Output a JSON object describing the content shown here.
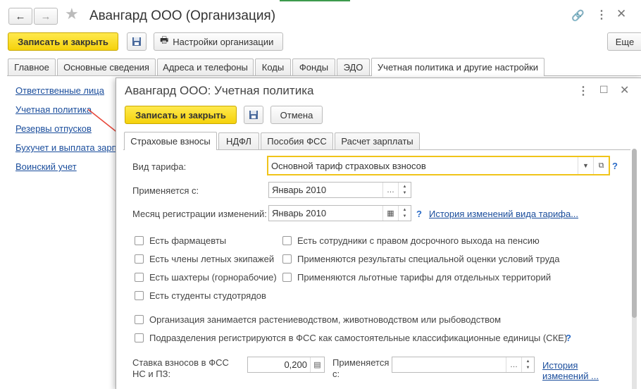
{
  "window": {
    "title": "Авангард ООО (Организация)",
    "save_close": "Записать и закрыть",
    "settings_btn": "Настройки организации",
    "more": "Еще",
    "tabs": [
      {
        "label": "Главное"
      },
      {
        "label": "Основные сведения"
      },
      {
        "label": "Адреса и телефоны"
      },
      {
        "label": "Коды"
      },
      {
        "label": "Фонды"
      },
      {
        "label": "ЭДО"
      },
      {
        "label": "Учетная политика и другие настройки"
      }
    ]
  },
  "left_links": [
    {
      "label": "Ответственные лица"
    },
    {
      "label": "Учетная политика"
    },
    {
      "label": "Резервы отпусков"
    },
    {
      "label": "Бухучет и выплата зарплаты"
    },
    {
      "label": "Воинский учет"
    }
  ],
  "dialog": {
    "title": "Авангард ООО: Учетная политика",
    "save_close": "Записать и закрыть",
    "cancel": "Отмена",
    "tabs": [
      {
        "label": "Страховые взносы"
      },
      {
        "label": "НДФЛ"
      },
      {
        "label": "Пособия ФСС"
      },
      {
        "label": "Расчет зарплаты"
      }
    ],
    "tariff_label": "Вид тарифа:",
    "tariff_value": "Основной тариф страховых взносов",
    "applies_label": "Применяется с:",
    "applies_value": "Январь 2010",
    "reg_month_label": "Месяц регистрации изменений:",
    "reg_month_value": "Январь 2010",
    "history_link": "История изменений вида тарифа...",
    "help_q": "?",
    "checks_left": [
      {
        "label": "Есть фармацевты"
      },
      {
        "label": "Есть члены летных экипажей"
      },
      {
        "label": "Есть шахтеры (горнорабочие)"
      },
      {
        "label": "Есть студенты студотрядов"
      }
    ],
    "checks_right": [
      {
        "label": "Есть сотрудники с правом досрочного выхода на пенсию"
      },
      {
        "label": "Применяются результаты специальной оценки условий труда"
      },
      {
        "label": "Применяются льготные тарифы для отдельных территорий"
      }
    ],
    "check_agro": "Организация занимается растениеводством, животноводством или рыбоводством",
    "check_ske": "Подразделения регистрируются в ФСС как самостоятельные классификационные единицы (СКЕ)",
    "rate_label_1": "Ставка взносов в ФСС",
    "rate_label_2": "НС и ПЗ:",
    "rate_value": "0,200",
    "rate_applies_1": "Применяется",
    "rate_applies_2": "с:",
    "rate_history_1": "История",
    "rate_history_2": "изменений ..."
  }
}
